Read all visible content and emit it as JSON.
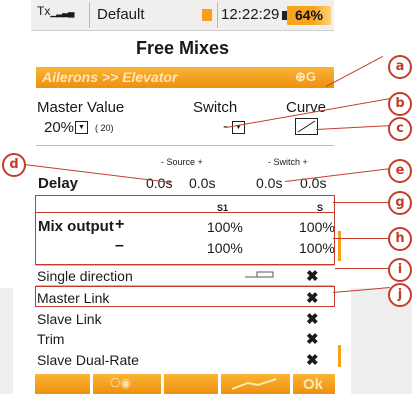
{
  "status": {
    "tx_label": "Tx",
    "profile": "Default",
    "time": "12:22:29",
    "battery": "64%",
    "orange_accent": "#f7a01a"
  },
  "title": "Free Mixes",
  "mix_name": "Ailerons >> Elevator",
  "mix_icon": "⊕G",
  "master": {
    "label": "Master Value",
    "value": "20%",
    "hint": "( 20)"
  },
  "switch": {
    "label": "Switch",
    "value": "-"
  },
  "curve": {
    "label": "Curve"
  },
  "delay": {
    "label": "Delay",
    "source_header": "- Source +",
    "switch_header": "- Switch +",
    "values": [
      "0.0s",
      "0.0s",
      "0.0s",
      "0.0s"
    ]
  },
  "mix_output": {
    "label": "Mix output",
    "col_headers": [
      "S1",
      "S"
    ],
    "plus_sign": "+",
    "minus_sign": "–",
    "plus_values": [
      "100%",
      "100%"
    ],
    "minus_values": [
      "100%",
      "100%"
    ]
  },
  "options": [
    {
      "label": "Single direction",
      "value": "✖"
    },
    {
      "label": "Master Link",
      "value": "✖"
    },
    {
      "label": "Slave Link",
      "value": "✖"
    },
    {
      "label": "Trim",
      "value": "✖"
    },
    {
      "label": "Slave Dual-Rate",
      "value": "✖"
    }
  ],
  "footer": {
    "ok": "Ok"
  },
  "callouts": [
    "a",
    "b",
    "c",
    "d",
    "e",
    "g",
    "h",
    "i",
    "j"
  ],
  "colors": {
    "callout": "#c33d2a",
    "bar": "#f5a21c"
  }
}
